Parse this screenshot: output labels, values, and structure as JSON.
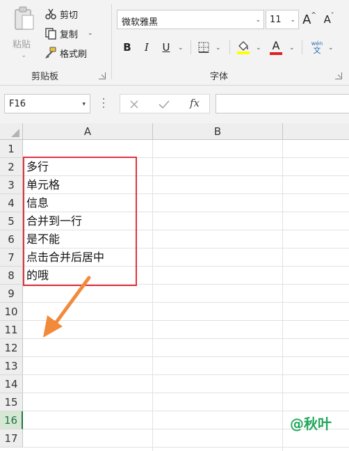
{
  "ribbon": {
    "clipboard": {
      "group_label": "剪贴板",
      "paste_label": "粘贴",
      "cut_label": "剪切",
      "copy_label": "复制",
      "format_painter_label": "格式刷"
    },
    "font": {
      "group_label": "字体",
      "font_name": "微软雅黑",
      "font_size": "11",
      "bold": "B",
      "italic": "I",
      "underline": "U",
      "font_color_letter": "A",
      "grow_font": "A",
      "shrink_font": "A",
      "phonetic_top": "wén",
      "phonetic_bottom": "文"
    }
  },
  "formula_bar": {
    "name_box": "F16",
    "formula": "",
    "fx_label": "fx"
  },
  "sheet": {
    "columns": [
      "A",
      "B"
    ],
    "rows": [
      "1",
      "2",
      "3",
      "4",
      "5",
      "6",
      "7",
      "8",
      "9",
      "10",
      "11",
      "12",
      "13",
      "14",
      "15",
      "16",
      "17"
    ],
    "selected_row": "16",
    "cells_a": [
      "",
      "多行",
      "单元格",
      "信息",
      "合并到一行",
      "是不能",
      "点击合并后居中",
      "的哦"
    ]
  },
  "colors": {
    "highlight_box": "#e0323c",
    "arrow": "#f28a3b",
    "watermark": "#21a75a",
    "font_color_bar": "#e02020",
    "fill_color_bar": "#ffff00"
  },
  "watermark": "@秋叶"
}
